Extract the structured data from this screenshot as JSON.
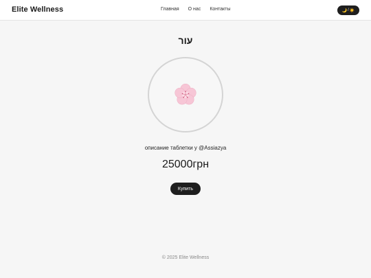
{
  "header": {
    "brand": "Elite Wellness",
    "nav": [
      {
        "label": "Главная"
      },
      {
        "label": "О нас"
      },
      {
        "label": "Контакты"
      }
    ],
    "theme_toggle": {
      "moon_icon": "🌙",
      "separator": "/",
      "sun_icon": "☀️"
    }
  },
  "product": {
    "title": "עור",
    "image_icon": "cherry-blossom-icon",
    "description": "описание таблетки у @Assiazya",
    "price": "25000грн",
    "buy_label": "Купить"
  },
  "footer": {
    "copyright": "© 2025 Elite Wellness"
  },
  "colors": {
    "background": "#f6f6f6",
    "header_bg": "#ffffff",
    "button_bg": "#1e1e1e",
    "blossom": "#f7c6d6"
  }
}
